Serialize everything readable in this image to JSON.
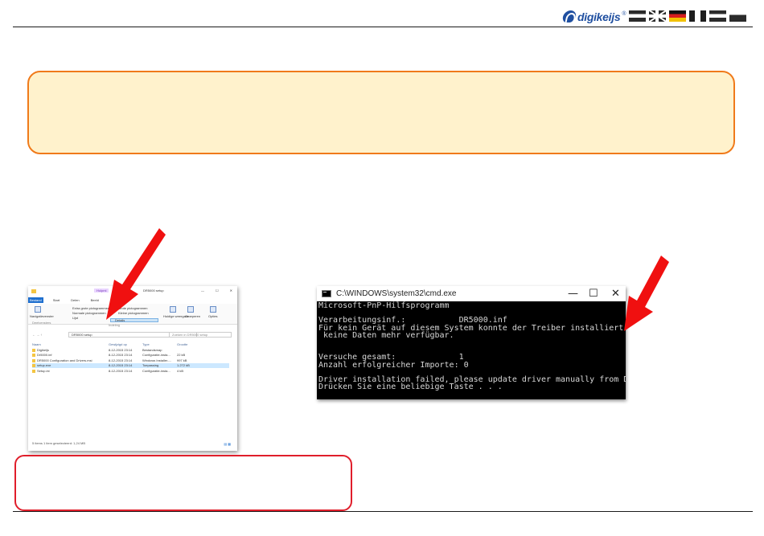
{
  "header": {
    "logo_text": "digikeijs",
    "logo_mark": "®",
    "flags": [
      "nl-flag",
      "uk-flag",
      "de-flag",
      "fr-flag",
      "lu-flag",
      "bl-flag"
    ]
  },
  "notice": {
    "text": ""
  },
  "note": {
    "text": ""
  },
  "explorer": {
    "manage_tab": "Hulpmi",
    "window_title": "DR5000 setup",
    "tabs": [
      "Bestand",
      "Start",
      "Delen",
      "Beeld"
    ],
    "ribbon": {
      "large_icons": "Extra grote pictogrammen",
      "normal_icons": "Normale pictogrammen",
      "list": "Lijst",
      "large_icons_2": "Grote pictogrammen",
      "small_icons": "Kleine pictogrammen",
      "details": "Details",
      "nav_pane": "Navigatievenster",
      "current_view": "Huidige weergave",
      "groups": "Groeperen",
      "options": "Opties",
      "section_panes": "Deelvensters",
      "section_layout": "Indeling"
    },
    "address": "DR5000 setup",
    "search_placeholder": "Zoeken in DR5000 setup",
    "columns": [
      "Naam",
      "Gewijzigd op",
      "Type",
      "Grootte"
    ],
    "rows": [
      {
        "name": "Digikeijs",
        "date": "8-12-2015 23:14",
        "type": "Bestandsmap",
        "size": ""
      },
      {
        "name": "Dr5000.inf",
        "date": "8-12-2015 23:14",
        "type": "Configuratie-insta...",
        "size": "22 kB"
      },
      {
        "name": "DR5000 Configuration and Drivers.msi",
        "date": "8-12-2015 23:14",
        "type": "Windows Installer-...",
        "size": "997 kB"
      },
      {
        "name": "setup.exe",
        "date": "8-12-2015 23:14",
        "type": "Toepassing",
        "size": "1.272 kB"
      },
      {
        "name": "Setup.ini",
        "date": "8-12-2015 23:14",
        "type": "Configuratie-insta...",
        "size": "4 kB"
      }
    ],
    "selected_row": 3,
    "status": "5 items    1 item geselecteerd: 1,24 MB"
  },
  "cmd": {
    "title": "C:\\WINDOWS\\system32\\cmd.exe",
    "minimize": "—",
    "maximize": "☐",
    "close": "✕",
    "lines": [
      "Microsoft-PnP-Hilfsprogramm",
      "",
      "Verarbeitungsinf.:           DR5000.inf",
      "Für kein Gerät auf diesem System konnte der Treiber installiert werden : Es sind",
      " keine Daten mehr verfügbar.",
      "",
      "",
      "Versuche gesamt:             1",
      "Anzahl erfolgreicher Importe: 0",
      "",
      "Driver installation failed, please update driver manually from DeviceManager",
      "Drücken Sie eine beliebige Taste . . ."
    ]
  },
  "colors": {
    "notice_fill": "#fff2cc",
    "notice_border": "#f07a1a",
    "note_border": "#e01e2b",
    "arrow": "#f01010",
    "brand": "#1f4fa0"
  }
}
